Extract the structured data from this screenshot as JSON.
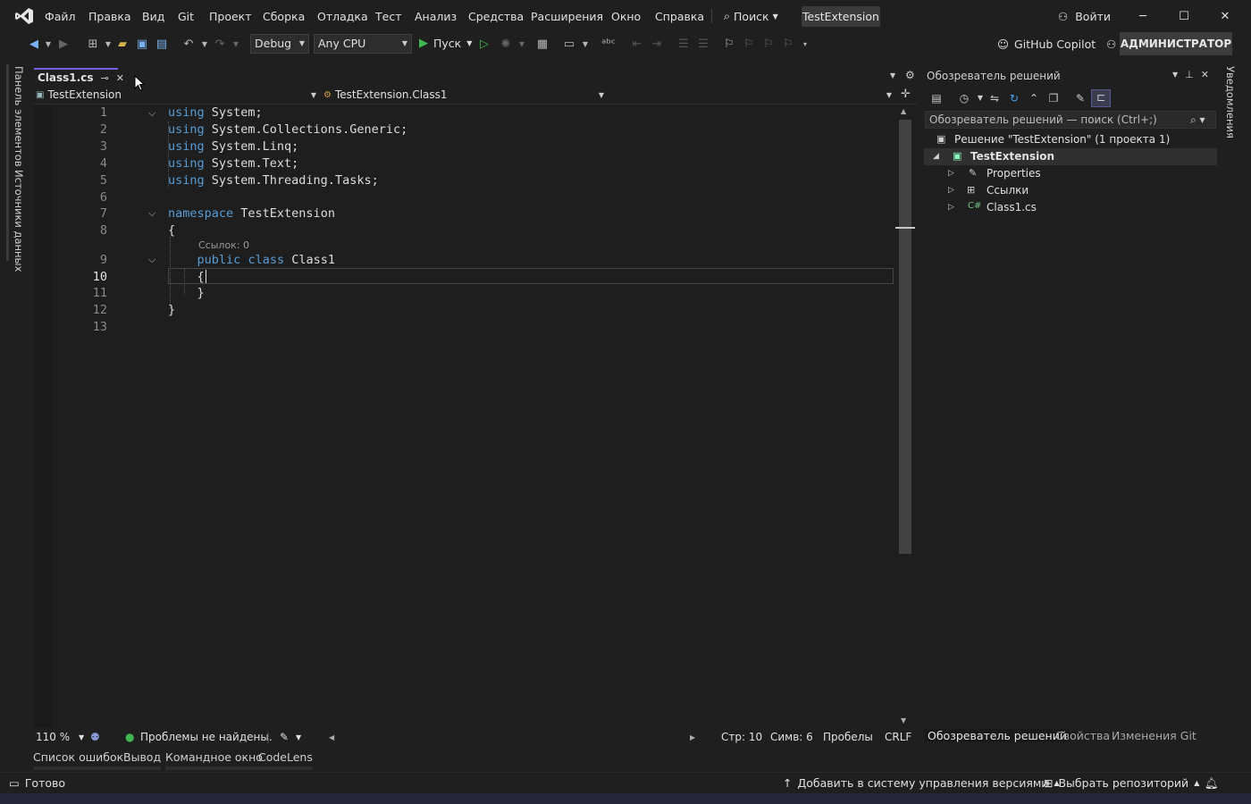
{
  "menu": {
    "items": [
      "Файл",
      "Правка",
      "Вид",
      "Git",
      "Проект",
      "Сборка",
      "Отладка",
      "Тест",
      "Анализ",
      "Средства",
      "Расширения",
      "Окно",
      "Справка"
    ],
    "search_label": "Поиск",
    "solution_title": "TestExtension",
    "signin_label": "Войти"
  },
  "toolbar": {
    "config": "Debug",
    "platform": "Any CPU",
    "run_label": "Пуск",
    "copilot_label": "GitHub Copilot",
    "admin_label": "АДМИНИСТРАТОР"
  },
  "left_strip": {
    "tabs": [
      "Панель элементов",
      "Источники данных"
    ]
  },
  "right_strip": {
    "tabs": [
      "Уведомления"
    ]
  },
  "editor": {
    "tab_label": "Class1.cs",
    "nav_project": "TestExtension",
    "nav_type": "TestExtension.Class1",
    "nav_member": "",
    "codelens": "Ссылок: 0",
    "current_line": 10,
    "lines": [
      {
        "n": "1",
        "parts": [
          {
            "t": "using",
            "c": "kw"
          },
          {
            "t": " System;",
            "c": "tx"
          }
        ]
      },
      {
        "n": "2",
        "parts": [
          {
            "t": "using",
            "c": "kw"
          },
          {
            "t": " System.Collections.Generic;",
            "c": "tx"
          }
        ]
      },
      {
        "n": "3",
        "parts": [
          {
            "t": "using",
            "c": "kw"
          },
          {
            "t": " System.Linq;",
            "c": "tx"
          }
        ]
      },
      {
        "n": "4",
        "parts": [
          {
            "t": "using",
            "c": "kw"
          },
          {
            "t": " System.Text;",
            "c": "tx"
          }
        ]
      },
      {
        "n": "5",
        "parts": [
          {
            "t": "using",
            "c": "kw"
          },
          {
            "t": " System.Threading.Tasks;",
            "c": "tx"
          }
        ]
      },
      {
        "n": "6",
        "parts": []
      },
      {
        "n": "7",
        "parts": [
          {
            "t": "namespace",
            "c": "kw"
          },
          {
            "t": " TestExtension",
            "c": "ns"
          }
        ]
      },
      {
        "n": "8",
        "parts": [
          {
            "t": "{",
            "c": "tx"
          }
        ]
      },
      {
        "n": "9",
        "parts": [
          {
            "t": "    ",
            "c": "tx"
          },
          {
            "t": "public",
            "c": "kw"
          },
          {
            "t": " ",
            "c": "tx"
          },
          {
            "t": "class",
            "c": "kw"
          },
          {
            "t": " Class1",
            "c": "cls"
          }
        ]
      },
      {
        "n": "10",
        "parts": [
          {
            "t": "    {",
            "c": "tx"
          }
        ]
      },
      {
        "n": "11",
        "parts": [
          {
            "t": "    }",
            "c": "tx"
          }
        ]
      },
      {
        "n": "12",
        "parts": [
          {
            "t": "}",
            "c": "tx"
          }
        ]
      },
      {
        "n": "13",
        "parts": []
      }
    ]
  },
  "editor_status": {
    "zoom": "110 %",
    "issues": "Проблемы не найдены.",
    "line": "Стр: 10",
    "col": "Симв: 6",
    "whitespace": "Пробелы",
    "eol": "CRLF"
  },
  "tool_tabs": [
    "Список ошибок",
    "Вывод",
    "Командное окно",
    "CodeLens"
  ],
  "solution_explorer": {
    "title": "Обозреватель решений",
    "search_placeholder": "Обозреватель решений — поиск (Ctrl+;)",
    "solution_label": "Решение \"TestExtension\" (1 проекта 1)",
    "project_label": "TestExtension",
    "items": [
      "Properties",
      "Ссылки",
      "Class1.cs"
    ],
    "bottom_tabs": [
      "Обозреватель решений",
      "Свойства",
      "Изменения Git"
    ]
  },
  "statusbar": {
    "ready": "Готово",
    "add_vcs": "Добавить в систему управления версиями",
    "select_repo": "Выбрать репозиторий"
  },
  "colors": {
    "accent": "#7160e8",
    "keyword": "#569cd6",
    "ok_green": "#3fb950"
  }
}
